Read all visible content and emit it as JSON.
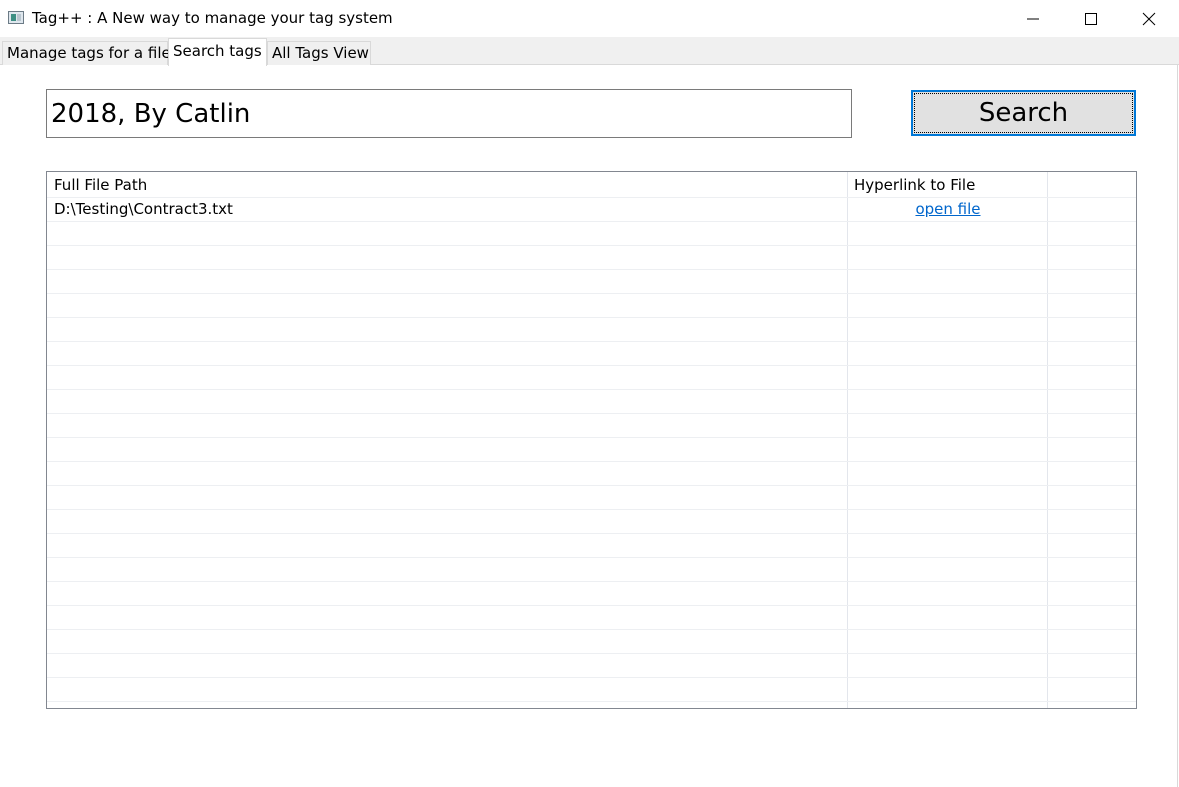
{
  "window": {
    "title": "Tag++ : A New way to manage your tag system",
    "app_icon": "app-window-icon",
    "controls": {
      "minimize_icon": "minimize-icon",
      "maximize_icon": "maximize-icon",
      "close_icon": "close-icon"
    }
  },
  "tabs": [
    {
      "label": "Manage tags for a file",
      "active": false
    },
    {
      "label": "Search tags",
      "active": true
    },
    {
      "label": "All Tags View",
      "active": false
    }
  ],
  "search": {
    "value": "2018, By Catlin",
    "button_label": "Search"
  },
  "results": {
    "columns": [
      "Full File Path",
      "Hyperlink to File",
      ""
    ],
    "rows": [
      {
        "path": "D:\\Testing\\Contract3.txt",
        "link": "open file"
      }
    ]
  },
  "colors": {
    "link": "#0066cc",
    "focus_border": "#0078d7",
    "button_face": "#e1e1e1"
  }
}
